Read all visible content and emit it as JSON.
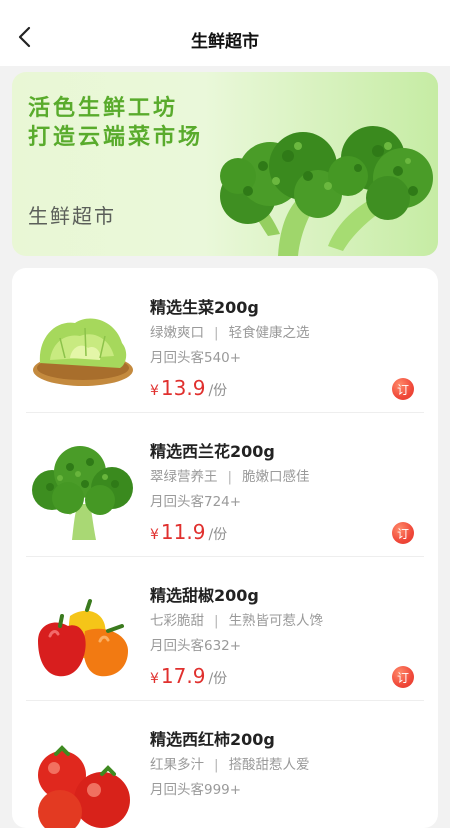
{
  "header": {
    "title": "生鲜超市",
    "back_icon": "chevron-left-icon"
  },
  "banner": {
    "slogan_line1": "活色生鲜工坊",
    "slogan_line2": "打造云端菜市场",
    "label": "生鲜超市",
    "image": "broccoli"
  },
  "products": [
    {
      "name": "精选生菜200g",
      "tag1": "绿嫩爽口",
      "tag2": "轻食健康之选",
      "repeat": "月回头客540+",
      "currency": "¥",
      "price": "13.9",
      "unit": "/份",
      "order_label": "订",
      "image": "lettuce"
    },
    {
      "name": "精选西兰花200g",
      "tag1": "翠绿营养王",
      "tag2": "脆嫩口感佳",
      "repeat": "月回头客724+",
      "currency": "¥",
      "price": "11.9",
      "unit": "/份",
      "order_label": "订",
      "image": "broccoli"
    },
    {
      "name": "精选甜椒200g",
      "tag1": "七彩脆甜",
      "tag2": "生熟皆可惹人馋",
      "repeat": "月回头客632+",
      "currency": "¥",
      "price": "17.9",
      "unit": "/份",
      "order_label": "订",
      "image": "bell-peppers"
    },
    {
      "name": "精选西红柿200g",
      "tag1": "红果多汁",
      "tag2": "搭酸甜惹人爱",
      "repeat": "月回头客999+",
      "currency": "¥",
      "price": "",
      "unit": "",
      "order_label": "",
      "image": "tomatoes"
    }
  ],
  "colors": {
    "accent_green": "#59ab2c",
    "price_red": "#e0302e",
    "page_bg": "#f2f2f2"
  }
}
